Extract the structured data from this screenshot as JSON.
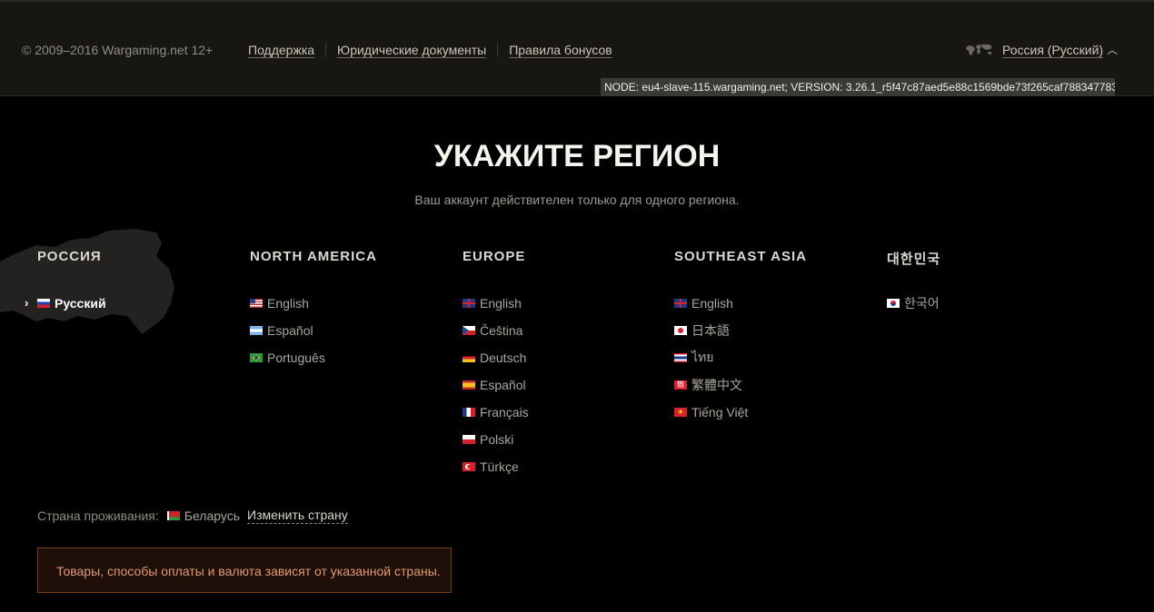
{
  "topbar": {
    "copyright": "© 2009–2016 Wargaming.net 12+",
    "links": [
      "Поддержка",
      "Юридические документы",
      "Правила бонусов"
    ],
    "region_label": "Россия (Русский)",
    "node_info": "NODE: eu4-slave-115.wargaming.net; VERSION: 3.26.1_r5f47c87aed5e88c1569bde73f265caf788347783"
  },
  "main": {
    "title": "УКАЖИТЕ РЕГИОН",
    "subtitle": "Ваш аккаунт действителен только для одного региона."
  },
  "regions": [
    {
      "name": "РОССИЯ",
      "langs": [
        {
          "label": "Русский",
          "flag": "ru",
          "active": true
        }
      ]
    },
    {
      "name": "NORTH AMERICA",
      "langs": [
        {
          "label": "English",
          "flag": "us"
        },
        {
          "label": "Español",
          "flag": "ar"
        },
        {
          "label": "Português",
          "flag": "br"
        }
      ]
    },
    {
      "name": "EUROPE",
      "langs": [
        {
          "label": "English",
          "flag": "gb"
        },
        {
          "label": "Čeština",
          "flag": "cz"
        },
        {
          "label": "Deutsch",
          "flag": "de"
        },
        {
          "label": "Español",
          "flag": "es"
        },
        {
          "label": "Français",
          "flag": "fr"
        },
        {
          "label": "Polski",
          "flag": "pl"
        },
        {
          "label": "Türkçe",
          "flag": "tr"
        }
      ]
    },
    {
      "name": "SOUTHEAST ASIA",
      "langs": [
        {
          "label": "English",
          "flag": "gb"
        },
        {
          "label": "日本語",
          "flag": "jp"
        },
        {
          "label": "ไทย",
          "flag": "th"
        },
        {
          "label": "繁體中文",
          "flag": "zh"
        },
        {
          "label": "Tiếng Việt",
          "flag": "vn"
        }
      ]
    },
    {
      "name": "대한민국",
      "langs": [
        {
          "label": "한국어",
          "flag": "kr"
        }
      ]
    }
  ],
  "country": {
    "label": "Страна проживания:",
    "value": "Беларусь",
    "change_link": "Изменить страну"
  },
  "notice": "Товары, способы оплаты и валюта зависят от указанной страны."
}
